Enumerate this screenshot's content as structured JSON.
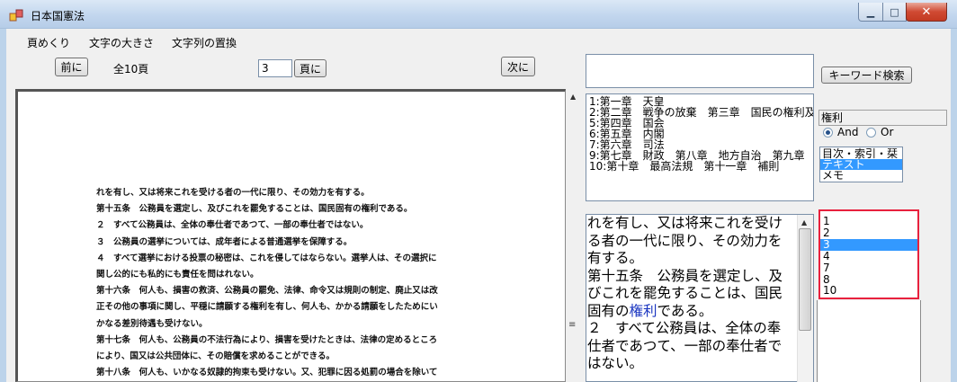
{
  "window": {
    "title": "日本国憲法"
  },
  "menu": [
    "頁めくり",
    "文字の大きさ",
    "文字列の置換"
  ],
  "pager": {
    "prev_label": "前に",
    "total_label": "全10頁",
    "page_value": "3",
    "goto_label": "頁に",
    "next_label": "次に"
  },
  "document": {
    "lines": [
      "れを有し、又は将来これを受ける者の一代に限り、その効力を有する。",
      "第十五条　公務員を選定し、及びこれを罷免することは、国民固有の権利である。",
      "２　すべて公務員は、全体の奉仕者であつて、一部の奉仕者ではない。",
      "３　公務員の選挙については、成年者による普通選挙を保障する。",
      "４　すべて選挙における投票の秘密は、これを侵してはならない。選挙人は、その選択に",
      "関し公的にも私的にも責任を問はれない。",
      "第十六条　何人も、損害の救済、公務員の罷免、法律、命令又は規則の制定、廃止又は改",
      "正その他の事項に関し、平穏に請願する権利を有し、何人も、かかる請願をしたためにい",
      "かなる差別待遇も受けない。",
      "第十七条　何人も、公務員の不法行為により、損害を受けたときは、法律の定めるところ",
      "により、国又は公共団体に、その賠償を求めることができる。",
      "第十八条　何人も、いかなる奴隷的拘束も受けない。又、犯罪に因る処罰の場合を除いて"
    ]
  },
  "search": {
    "keyword_value": "",
    "button_label": "キーワード検索",
    "term_value": "権利",
    "and_label": "And",
    "or_label": "Or",
    "scope": [
      "目次・索引・栞",
      "テキスト",
      "メモ"
    ],
    "scope_selected": "テキスト"
  },
  "toc": [
    "1:第一章　天皇",
    "2:第二章　戦争の放棄　第三章　国民の権利及",
    "5:第四章　国会",
    "6:第五章　内閣",
    "7:第六章　司法",
    "9:第七章　財政　第八章　地方自治　第九章",
    "10:第十章　最高法規　第十一章　補則"
  ],
  "text_view": {
    "l1": "れを有し、又は将来これを受け",
    "l2": "る者の一代に限り、その効力を",
    "l3": "有する。",
    "l4": "第十五条　公務員を選定し、及",
    "l5": "びこれを罷免することは、国民",
    "l6a": "固有の",
    "l6_link": "権利",
    "l6b": "である。",
    "l7": "２　すべて公務員は、全体の奉",
    "l8": "仕者であつて、一部の奉仕者で",
    "l9": "はない。"
  },
  "hit_pages": [
    "1",
    "2",
    "3",
    "4",
    "7",
    "8",
    "10"
  ],
  "hit_pages_selected": "3",
  "colors": {
    "selection": "#3399ff",
    "highlight_border": "#e8213d",
    "link": "#1a35c0"
  }
}
